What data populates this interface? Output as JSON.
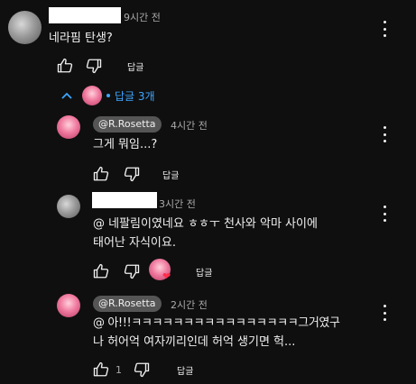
{
  "comment": {
    "time": "9시간 전",
    "text": "네라핌 탄생?",
    "reply_label": "답글"
  },
  "replies_toggle": {
    "label": "답글 3개"
  },
  "replies": [
    {
      "author": "@R.Rosetta",
      "time": "4시간 전",
      "text": "그게 뭐임...?",
      "reply_label": "답글"
    },
    {
      "time": "3시간 전",
      "line1": "@ 네팔림이였네요 ㅎㅎㅜ  천사와 악마 사이에",
      "line2": "태어난 자식이요.",
      "reply_label": "답글"
    },
    {
      "author": "@R.Rosetta",
      "time": "2시간 전",
      "line1": "@ 아!!!ㅋㅋㅋㅋㅋㅋㅋㅋㅋㅋㅋㅋㅋㅋㅋㅋ그거였구",
      "line2": "나 허어억 여자끼리인데 허억 생기면 헉...",
      "like_count": "1",
      "reply_label": "답글"
    }
  ]
}
